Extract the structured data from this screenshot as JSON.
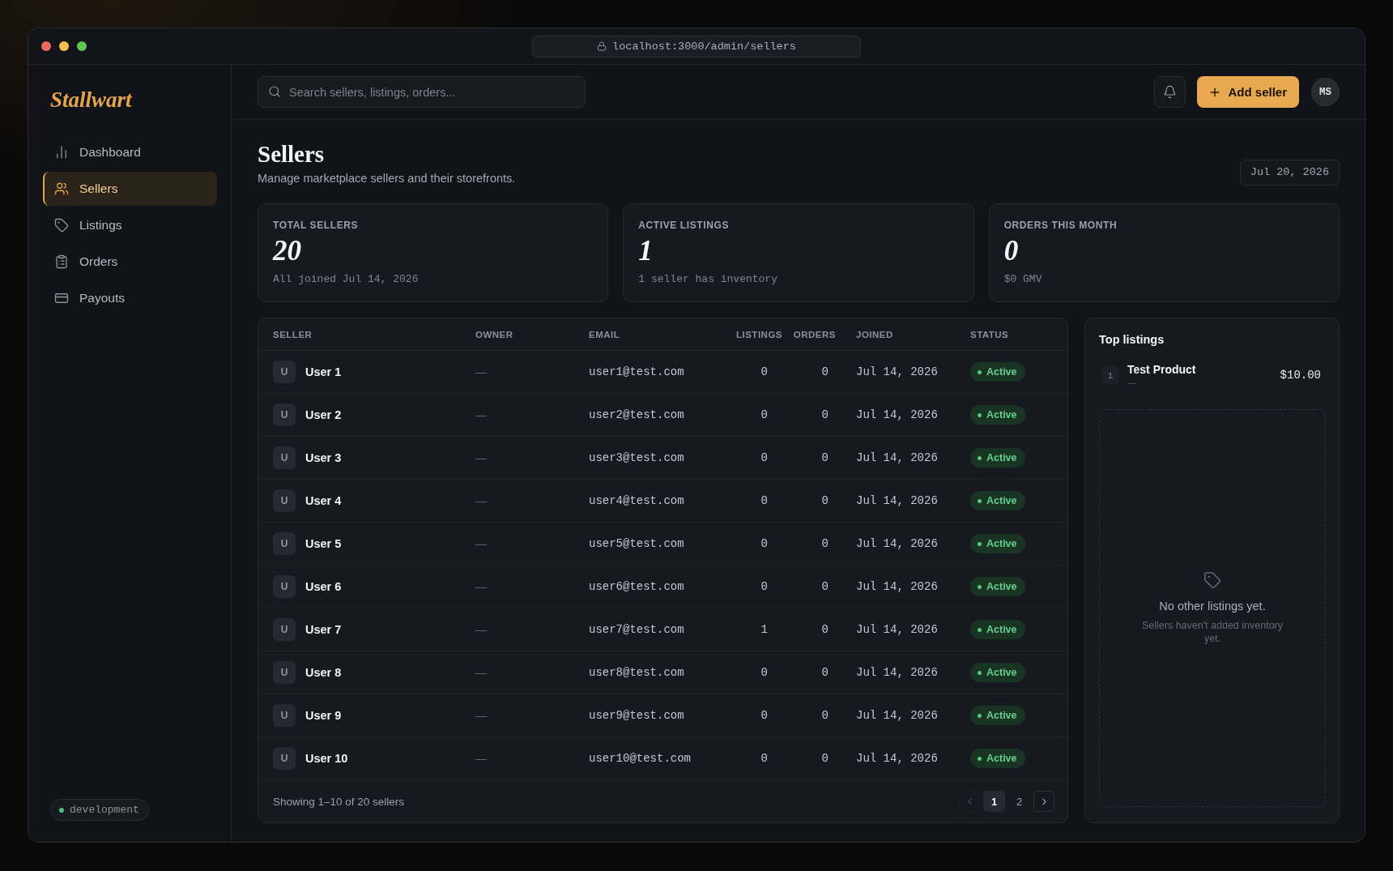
{
  "window": {
    "url": "localhost:3000/admin/sellers"
  },
  "sidebar": {
    "logo": "Stallwart",
    "items": [
      {
        "label": "Dashboard",
        "selected": false
      },
      {
        "label": "Sellers",
        "selected": true
      },
      {
        "label": "Listings",
        "selected": false
      },
      {
        "label": "Orders",
        "selected": false
      },
      {
        "label": "Payouts",
        "selected": false
      }
    ],
    "environment": "development"
  },
  "topbar": {
    "search": {
      "placeholder": "Search sellers, listings, orders..."
    },
    "add_button": "Add seller",
    "avatar": "MS"
  },
  "page": {
    "title": "Sellers",
    "subtitle": "Manage marketplace sellers and their storefronts.",
    "date": "Jul 20, 2026"
  },
  "stats": [
    {
      "label": "TOTAL SELLERS",
      "value": "20",
      "note": "All joined Jul 14, 2026"
    },
    {
      "label": "ACTIVE LISTINGS",
      "value": "1",
      "note": "1 seller has inventory"
    },
    {
      "label": "ORDERS THIS MONTH",
      "value": "0",
      "note": "$0 GMV"
    }
  ],
  "table": {
    "columns": [
      "SELLER",
      "OWNER",
      "EMAIL",
      "LISTINGS",
      "ORDERS",
      "JOINED",
      "STATUS"
    ],
    "rows": [
      {
        "avatar": "U",
        "name": "User 1",
        "owner": "—",
        "email": "user1@test.com",
        "listings": "0",
        "orders": "0",
        "joined": "Jul 14, 2026",
        "status": "Active"
      },
      {
        "avatar": "U",
        "name": "User 2",
        "owner": "—",
        "email": "user2@test.com",
        "listings": "0",
        "orders": "0",
        "joined": "Jul 14, 2026",
        "status": "Active"
      },
      {
        "avatar": "U",
        "name": "User 3",
        "owner": "—",
        "email": "user3@test.com",
        "listings": "0",
        "orders": "0",
        "joined": "Jul 14, 2026",
        "status": "Active"
      },
      {
        "avatar": "U",
        "name": "User 4",
        "owner": "—",
        "email": "user4@test.com",
        "listings": "0",
        "orders": "0",
        "joined": "Jul 14, 2026",
        "status": "Active"
      },
      {
        "avatar": "U",
        "name": "User 5",
        "owner": "—",
        "email": "user5@test.com",
        "listings": "0",
        "orders": "0",
        "joined": "Jul 14, 2026",
        "status": "Active"
      },
      {
        "avatar": "U",
        "name": "User 6",
        "owner": "—",
        "email": "user6@test.com",
        "listings": "0",
        "orders": "0",
        "joined": "Jul 14, 2026",
        "status": "Active"
      },
      {
        "avatar": "U",
        "name": "User 7",
        "owner": "—",
        "email": "user7@test.com",
        "listings": "1",
        "orders": "0",
        "joined": "Jul 14, 2026",
        "status": "Active"
      },
      {
        "avatar": "U",
        "name": "User 8",
        "owner": "—",
        "email": "user8@test.com",
        "listings": "0",
        "orders": "0",
        "joined": "Jul 14, 2026",
        "status": "Active"
      },
      {
        "avatar": "U",
        "name": "User 9",
        "owner": "—",
        "email": "user9@test.com",
        "listings": "0",
        "orders": "0",
        "joined": "Jul 14, 2026",
        "status": "Active"
      },
      {
        "avatar": "U",
        "name": "User 10",
        "owner": "—",
        "email": "user10@test.com",
        "listings": "0",
        "orders": "0",
        "joined": "Jul 14, 2026",
        "status": "Active"
      }
    ],
    "footer": "Showing 1–10 of 20 sellers",
    "pagination": {
      "prev": {
        "disabled": true
      },
      "pages": [
        {
          "label": "1",
          "selected": true
        },
        {
          "label": "2",
          "selected": false
        }
      ],
      "next": {
        "disabled": false
      }
    }
  },
  "top_listings": {
    "title": "Top listings",
    "items": [
      {
        "rank": "1",
        "name": "Test Product",
        "subtitle": "—",
        "price": "$10.00"
      }
    ],
    "empty": {
      "title": "No other listings yet.",
      "text": "Sellers haven't added inventory yet."
    }
  }
}
